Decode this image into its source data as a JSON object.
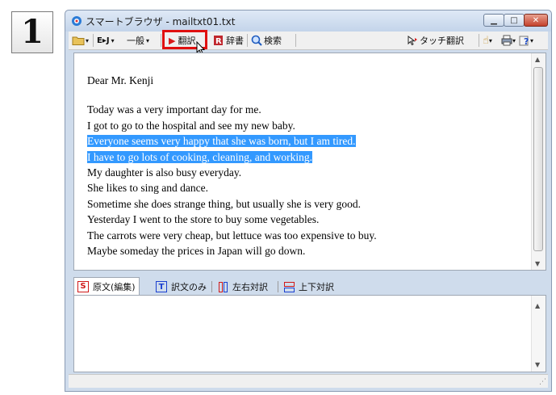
{
  "step_number": "1",
  "window": {
    "title": "スマートブラウザ - mailtxt01.txt"
  },
  "toolbar": {
    "ej_label": "E▸J",
    "mode_label": "一般",
    "translate_label": "翻訳",
    "dictionary_label": "辞書",
    "search_label": "検索",
    "touch_translate_label": "タッチ翻訳"
  },
  "editor": {
    "salutation": "Dear Mr. Kenji",
    "lines": [
      "Today was a very important day for me.",
      "I got to go to the hospital and see my new baby.",
      "Everyone seems very happy that she was born, but I am tired.",
      "I have to go lots of cooking, cleaning, and working.",
      "My daughter is also busy everyday.",
      "She likes to sing and dance.",
      "Sometime she does strange thing, but usually she is very good.",
      "Yesterday I went to the store to buy some vegetables.",
      "The carrots were very cheap, but lettuce was too expensive to buy.",
      "Maybe someday the prices in Japan will go down."
    ]
  },
  "tabs": [
    {
      "icon": "S",
      "label": "原文(編集)"
    },
    {
      "icon": "T",
      "label": "訳文のみ"
    },
    {
      "icon": "",
      "label": "左右対訳"
    },
    {
      "icon": "",
      "label": "上下対訳"
    }
  ],
  "colors": {
    "selection": "#3399ff",
    "highlight_box": "#e01010",
    "tab_icon": "#d01818",
    "tab_icon_blue": "#1a3fd0"
  }
}
